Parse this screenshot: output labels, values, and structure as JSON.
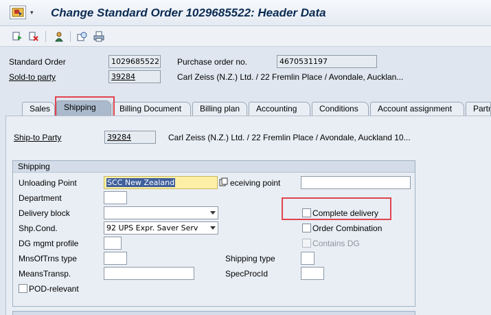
{
  "window": {
    "title": "Change Standard Order 1029685522: Header Data"
  },
  "toolbar": {
    "icons": [
      "display-other-document-icon",
      "cancel-icon",
      "user-icon",
      "view-icon",
      "print-icon"
    ]
  },
  "header": {
    "standard_order_label": "Standard Order",
    "standard_order_value": "1029685522",
    "po_label": "Purchase order no.",
    "po_value": "4670531197",
    "sold_to_label": "Sold-to party",
    "sold_to_value": "39284",
    "sold_to_desc": "Carl Zeiss (N.Z.) Ltd. / 22 Fremlin Place / Avondale, Aucklan..."
  },
  "tabs": [
    "Sales",
    "Shipping",
    "Billing Document",
    "Billing plan",
    "Accounting",
    "Conditions",
    "Account assignment",
    "Partn"
  ],
  "active_tab": "Shipping",
  "shipping": {
    "ship_to_label": "Ship-to Party",
    "ship_to_value": "39284",
    "ship_to_desc": "Carl Zeiss (N.Z.) Ltd. / 22 Fremlin Place / Avondale, Auckland 10...",
    "group_title": "Shipping",
    "unloading_point_label": "Unloading Point",
    "unloading_point_value": "SCC New Zealand",
    "receiving_point_label": "eceiving point",
    "receiving_point_value": "",
    "department_label": "Department",
    "department_value": "",
    "delivery_block_label": "Delivery block",
    "delivery_block_value": "",
    "complete_delivery_label": "Complete delivery",
    "shp_cond_label": "Shp.Cond.",
    "shp_cond_value": "92 UPS Expr. Saver Serv",
    "order_combination_label": "Order Combination",
    "dg_mgmt_label": "DG mgmt profile",
    "dg_mgmt_value": "",
    "contains_dg_label": "Contains DG",
    "mns_of_trns_label": "MnsOfTrns type",
    "mns_of_trns_value": "",
    "shipping_type_label": "Shipping type",
    "shipping_type_value": "",
    "means_transp_label": "MeansTransp.",
    "means_transp_value": "",
    "spec_proc_label": "SpecProcId",
    "spec_proc_value": "",
    "pod_relevant_label": "POD-relevant"
  },
  "colors": {
    "highlight": "#e0434e",
    "active_tab": "#aab9cb",
    "title": "#0b2a52"
  }
}
